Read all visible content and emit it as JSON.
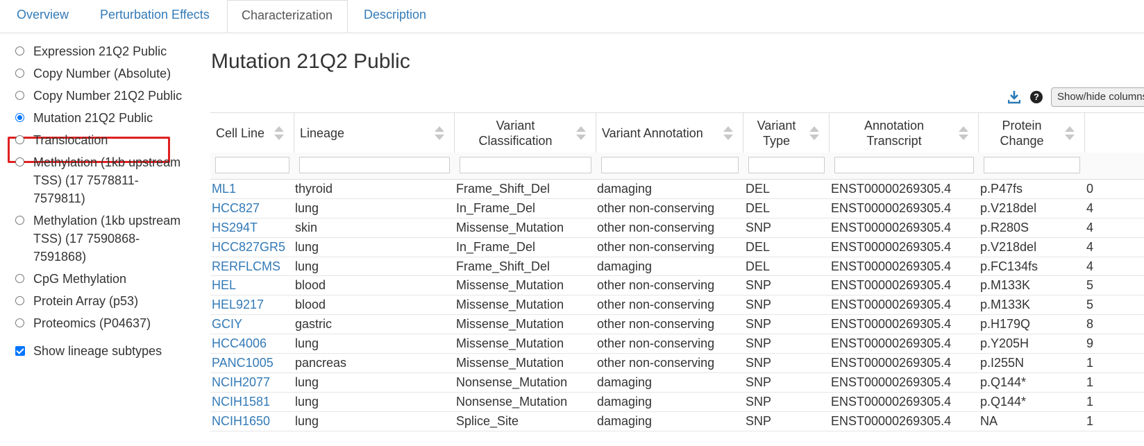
{
  "tabs": [
    "Overview",
    "Perturbation Effects",
    "Characterization",
    "Description"
  ],
  "sidebar": {
    "options": [
      {
        "label": "Expression 21Q2 Public",
        "checked": false
      },
      {
        "label": "Copy Number (Absolute)",
        "checked": false
      },
      {
        "label": "Copy Number 21Q2 Public",
        "checked": false
      },
      {
        "label": "Mutation 21Q2 Public",
        "checked": true
      },
      {
        "label": "Translocation",
        "checked": false
      },
      {
        "label": "Methylation (1kb upstream TSS) (17 7578811-7579811)",
        "lines": [
          "Methylation (1kb upstream",
          "TSS) (17 7578811-",
          "7579811)"
        ],
        "checked": false
      },
      {
        "label": "Methylation (1kb upstream TSS) (17 7590868-7591868)",
        "lines": [
          "Methylation (1kb upstream",
          "TSS) (17 7590868-",
          "7591868)"
        ],
        "checked": false
      },
      {
        "label": "CpG Methylation",
        "checked": false
      },
      {
        "label": "Protein Array (p53)",
        "checked": false
      },
      {
        "label": "Proteomics (P04637)",
        "checked": false
      }
    ],
    "show_subtypes": {
      "label": "Show lineage subtypes",
      "checked": true
    }
  },
  "main": {
    "title": "Mutation 21Q2 Public",
    "show_button": "Show/hide columns",
    "columns": [
      [
        "Cell Line"
      ],
      [
        "Lineage"
      ],
      [
        "Variant",
        "Classification"
      ],
      [
        "Variant Annotation"
      ],
      [
        "Variant",
        "Type"
      ],
      [
        "Annotation",
        "Transcript"
      ],
      [
        "Protein",
        "Change"
      ]
    ],
    "rows": [
      [
        "ML1",
        "thyroid",
        "Frame_Shift_Del",
        "damaging",
        "DEL",
        "ENST00000269305.4",
        "p.P47fs",
        "0"
      ],
      [
        "HCC827",
        "lung",
        "In_Frame_Del",
        "other non-conserving",
        "DEL",
        "ENST00000269305.4",
        "p.V218del",
        "4"
      ],
      [
        "HS294T",
        "skin",
        "Missense_Mutation",
        "other non-conserving",
        "SNP",
        "ENST00000269305.4",
        "p.R280S",
        "4"
      ],
      [
        "HCC827GR5",
        "lung",
        "In_Frame_Del",
        "other non-conserving",
        "DEL",
        "ENST00000269305.4",
        "p.V218del",
        "4"
      ],
      [
        "RERFLCMS",
        "lung",
        "Frame_Shift_Del",
        "damaging",
        "DEL",
        "ENST00000269305.4",
        "p.FC134fs",
        "4"
      ],
      [
        "HEL",
        "blood",
        "Missense_Mutation",
        "other non-conserving",
        "SNP",
        "ENST00000269305.4",
        "p.M133K",
        "5"
      ],
      [
        "HEL9217",
        "blood",
        "Missense_Mutation",
        "other non-conserving",
        "SNP",
        "ENST00000269305.4",
        "p.M133K",
        "5"
      ],
      [
        "GCIY",
        "gastric",
        "Missense_Mutation",
        "other non-conserving",
        "SNP",
        "ENST00000269305.4",
        "p.H179Q",
        "8"
      ],
      [
        "HCC4006",
        "lung",
        "Missense_Mutation",
        "other non-conserving",
        "SNP",
        "ENST00000269305.4",
        "p.Y205H",
        "9"
      ],
      [
        "PANC1005",
        "pancreas",
        "Missense_Mutation",
        "other non-conserving",
        "SNP",
        "ENST00000269305.4",
        "p.I255N",
        "1"
      ],
      [
        "NCIH2077",
        "lung",
        "Nonsense_Mutation",
        "damaging",
        "SNP",
        "ENST00000269305.4",
        "p.Q144*",
        "1"
      ],
      [
        "NCIH1581",
        "lung",
        "Nonsense_Mutation",
        "damaging",
        "SNP",
        "ENST00000269305.4",
        "p.Q144*",
        "1"
      ],
      [
        "NCIH1650",
        "lung",
        "Splice_Site",
        "damaging",
        "SNP",
        "ENST00000269305.4",
        "NA",
        "1"
      ]
    ]
  },
  "colors": {
    "link": "#337ab7",
    "highlight": "#e02020",
    "download_icon": "#2a7ab8"
  }
}
